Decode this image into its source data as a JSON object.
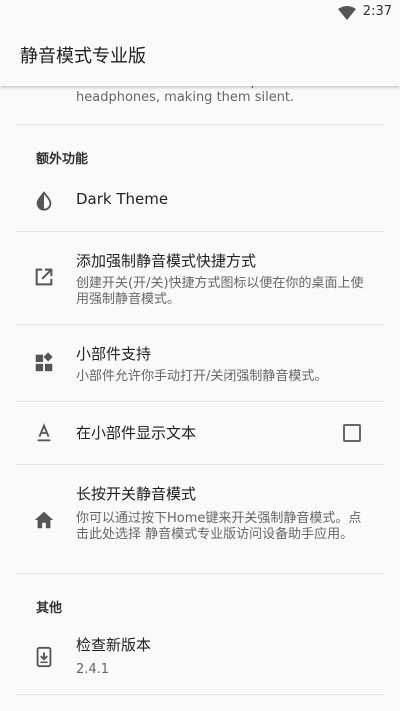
{
  "status_bar": {
    "time": "2:37"
  },
  "app_bar": {
    "title": "静音模式专业版"
  },
  "clipped_summary": "Forces all sounds to be output to the headphones, making them silent.",
  "sections": {
    "extra": "额外功能",
    "other": "其他"
  },
  "prefs": {
    "dark_theme": {
      "title": "Dark Theme"
    },
    "shortcut": {
      "title": "添加强制静音模式快捷方式",
      "summary": "创建开关(开/关)快捷方式图标以便在你的桌面上使用强制静音模式。"
    },
    "widget": {
      "title": "小部件支持",
      "summary": "小部件允许你手动打开/关闭强制静音模式。"
    },
    "widget_text": {
      "title": "在小部件显示文本",
      "checked": false
    },
    "long_press_home": {
      "title": "长按开关静音模式",
      "summary": "你可以通过按下Home键来开关强制静音模式。点击此处选择 静音模式专业版访问设备助手应用。"
    },
    "check_update": {
      "title": "检查新版本",
      "summary": "2.4.1"
    }
  },
  "colors": {
    "icon": "#555555",
    "divider": "#e6e6e6",
    "background": "#fafafa"
  }
}
